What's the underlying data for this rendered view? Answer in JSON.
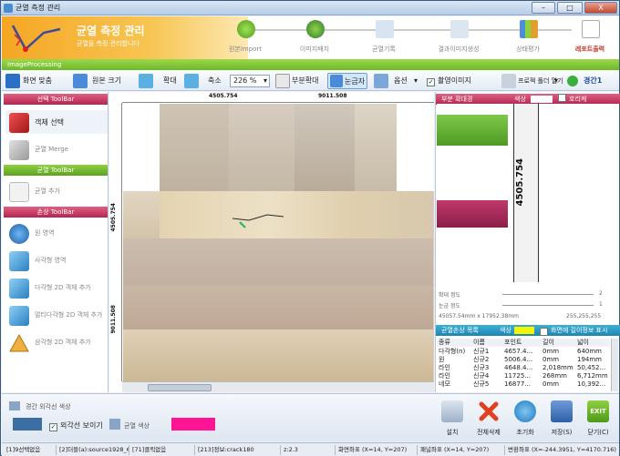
{
  "window": {
    "title": "균열 측정 관리",
    "close_label": "X"
  },
  "header": {
    "title": "균열 측정 관리",
    "subtitle": "균열을 측정 관리합니다"
  },
  "steps": [
    {
      "label": "원본Import"
    },
    {
      "label": "이미지배치"
    },
    {
      "label": "균열기록"
    },
    {
      "label": "결과이미지생성"
    },
    {
      "label": "상태평가"
    },
    {
      "label": "레포트출력"
    }
  ],
  "banner": "ImageProcessing",
  "toolbar": {
    "fit_screen": "화면 맞춤",
    "original_size": "원본 크기",
    "zoom_in": "확대",
    "zoom_out": "축소",
    "zoom_level": "226 %",
    "partial_zoom": "부분확대",
    "grid": "눈금자",
    "options": "옵션",
    "capture": "촬영이미지",
    "tool_folder": "프로젝 폴더 열기",
    "span": "경간1"
  },
  "left": {
    "select_toolbar": "선택 ToolBar",
    "object_select": "객체 선택",
    "crack_merge": "균열 Merge",
    "crack_toolbar": "균열 ToolBar",
    "crack_add": "균열 추가",
    "damage_toolbar": "손상 ToolBar",
    "items": [
      "원 영역",
      "사각형 영역",
      "다각형 2D 객체 추가",
      "멀티다각형 2D 객체 추가",
      "삼각형 2D 객체 추가"
    ]
  },
  "canvas": {
    "h_tick1": "4505.754",
    "h_tick2": "9011.508",
    "v_tick1": "4505.754",
    "v_tick2": "9011.508"
  },
  "right": {
    "zoom_header": "부분 확대경",
    "color_label": "색상",
    "crack_dir": "호리케",
    "zoom_value": "4505.754",
    "zoom_grid_lbl": "확대 정도",
    "zoom_grid_val": "2",
    "grid_size_lbl": "눈금 정도",
    "grid_size_val": "1",
    "coords": "45057.54mm x 17952.38mm",
    "rgb": "255,255,255",
    "damage_header": "균열손상 목록",
    "damage_color": "색상",
    "show_length": "화면에 길이정보 표시",
    "columns": [
      "종류",
      "이름",
      "포인트",
      "길이",
      "넓이"
    ],
    "rows": [
      [
        "다각형(n)",
        "신규1",
        "4657.4...",
        "0mm",
        "640mm"
      ],
      [
        "원",
        "신규2",
        "5006.4...",
        "0mm",
        "194mm"
      ],
      [
        "라인",
        "신규3",
        "4648.4...",
        "2,018mm",
        "50,452..."
      ],
      [
        "라인",
        "신규4",
        "11725...",
        "268mm",
        "6,712mm"
      ],
      [
        "네모",
        "신규5",
        "16877...",
        "0mm",
        "10,392..."
      ]
    ]
  },
  "bottom": {
    "outline_color": "경간 외각선 색상",
    "show_outline": "외각선 보이기",
    "crack_color": "균열 색상",
    "buttons": [
      "설치",
      "전체삭제",
      "초기화",
      "저장(S)",
      "닫기(C)"
    ]
  },
  "status": [
    "[1]9선택없음",
    "[2]더블(a):source1928_6",
    "[71]클릭없음",
    "[213]정보:crack180",
    "z:2.3",
    "화면좌표 (X=14, Y=207)",
    "패널좌표 (X=14, Y=207)",
    "변환좌표 (X=-244.3951, Y=4170.716)"
  ],
  "colors": {
    "accent_orange": "#f5a623",
    "accent_green": "#6fb82a",
    "outline_swatch": "#3a6ea5",
    "crack_swatch": "#ff1493"
  }
}
